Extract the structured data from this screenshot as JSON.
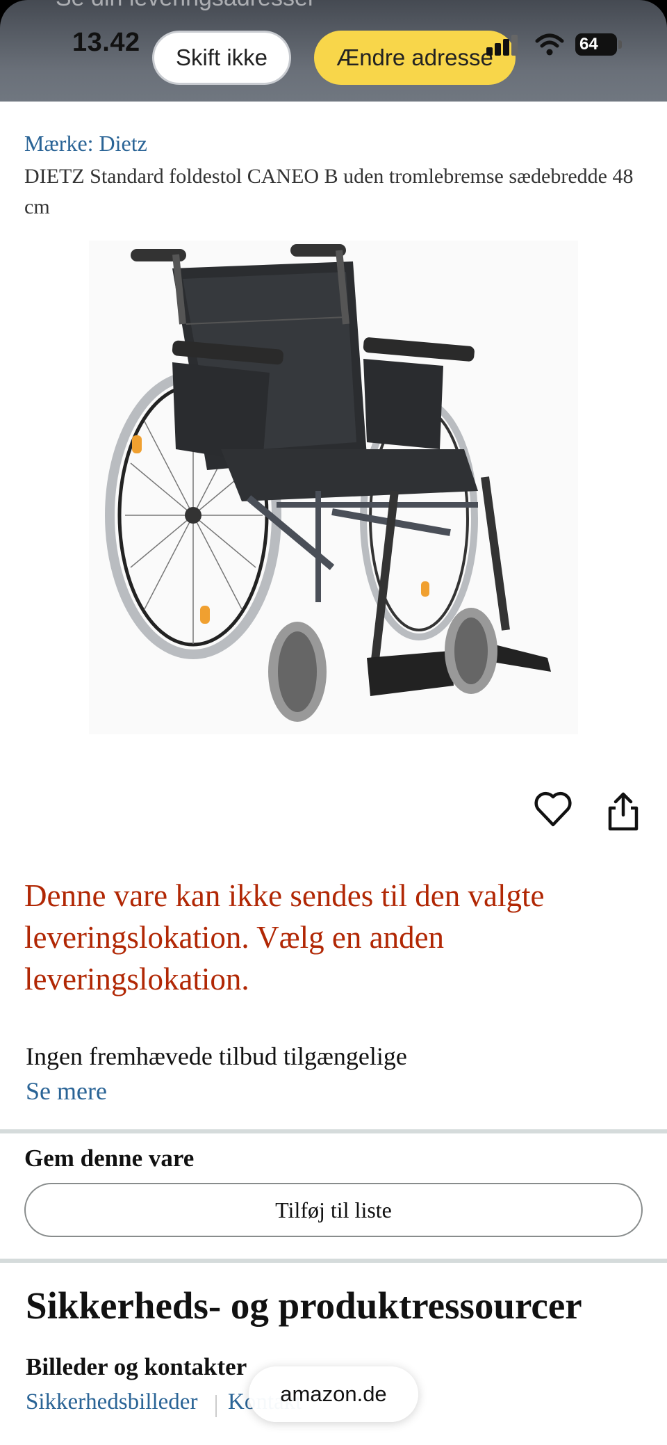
{
  "sheet": {
    "ghost_text": "Se din leveringsadresser",
    "skift_button": "Skift ikke",
    "aendre_button": "Ændre adresse"
  },
  "status_bar": {
    "time": "13.42",
    "battery": "64"
  },
  "product": {
    "brand": "Mærke: Dietz",
    "title": "DIETZ Standard foldestol CANEO B uden tromlebremse sædebredde 48 cm"
  },
  "availability": {
    "warning": "Denne vare kan ikke sendes til den valgte leveringslokation. Vælg en anden leveringslokation.",
    "offers": "Ingen fremhævede tilbud tilgængelige",
    "see_more": "Se mere"
  },
  "save": {
    "heading": "Gem denne vare",
    "add_to_list": "Tilføj til liste"
  },
  "safety": {
    "heading": "Sikkerheds- og produktressourcer",
    "contacts_heading": "Billeder og kontakter",
    "images_link": "Sikkerhedsbilleder",
    "contacts_link": "Kontakt"
  },
  "browser": {
    "domain": "amazon.de"
  },
  "colors": {
    "link": "#2a6496",
    "warning": "#b12704",
    "accent_button": "#f8d64a"
  }
}
